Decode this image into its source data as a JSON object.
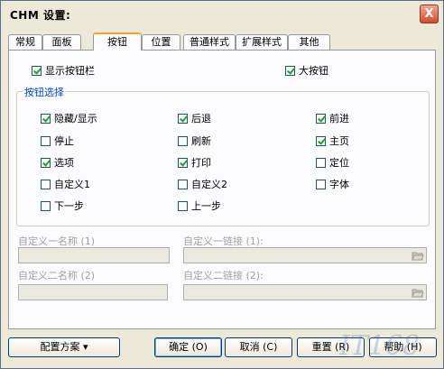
{
  "window": {
    "title": "CHM 设置:",
    "close_label": "X"
  },
  "tabs": [
    {
      "label": "常规"
    },
    {
      "label": "面板"
    },
    {
      "label": "按钮"
    },
    {
      "label": "位置"
    },
    {
      "label": "普通样式"
    },
    {
      "label": "扩展样式"
    },
    {
      "label": "其他"
    }
  ],
  "top_options": {
    "show_toolbar": {
      "label": "显示按钮栏",
      "checked": true
    },
    "large_buttons": {
      "label": "大按钮",
      "checked": true
    }
  },
  "button_group": {
    "title": "按钮选择",
    "items": [
      {
        "label": "隐藏/显示",
        "checked": true
      },
      {
        "label": "后退",
        "checked": true
      },
      {
        "label": "前进",
        "checked": true
      },
      {
        "label": "停止",
        "checked": false
      },
      {
        "label": "刷新",
        "checked": false
      },
      {
        "label": "主页",
        "checked": true
      },
      {
        "label": "选项",
        "checked": true
      },
      {
        "label": "打印",
        "checked": true
      },
      {
        "label": "定位",
        "checked": false
      },
      {
        "label": "自定义1",
        "checked": false
      },
      {
        "label": "自定义2",
        "checked": false
      },
      {
        "label": "字体",
        "checked": false
      },
      {
        "label": "下一步",
        "checked": false
      },
      {
        "label": "上一步",
        "checked": false
      }
    ]
  },
  "custom_fields": {
    "name1_label": "自定义一名称 (1)",
    "link1_label": "自定义一链接 (1):",
    "name2_label": "自定义二名称 (2)",
    "link2_label": "自定义二链接 (2):"
  },
  "buttons": {
    "scheme": "配置方案 ▾",
    "ok": "确定 (O)",
    "cancel": "取消 (C)",
    "reset": "重置 (R)",
    "help": "帮助 (H)"
  }
}
